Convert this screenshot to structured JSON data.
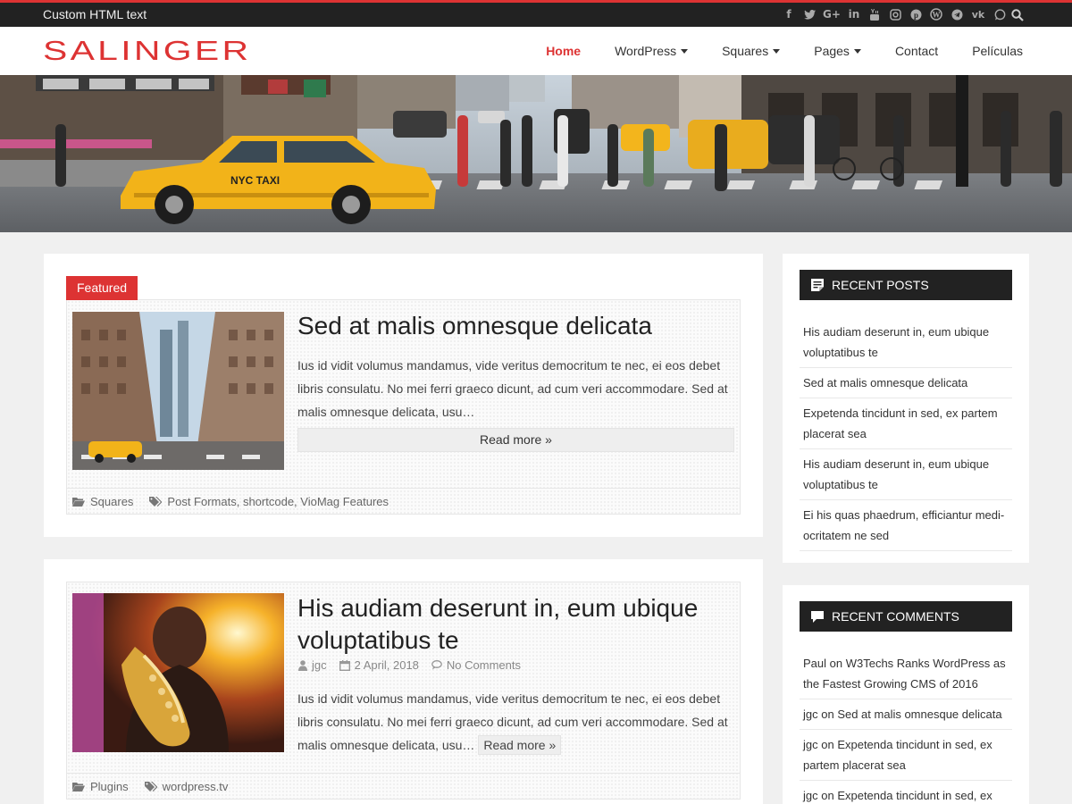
{
  "topbar": {
    "text": "Custom HTML text",
    "social_icons": [
      "facebook-icon",
      "twitter-icon",
      "google-plus-icon",
      "linkedin-icon",
      "youtube-icon",
      "instagram-icon",
      "pinterest-icon",
      "wordpress-icon",
      "telegram-icon",
      "vk-icon",
      "whatsapp-icon",
      "search-icon"
    ]
  },
  "header": {
    "logo": "SALINGER",
    "nav": [
      {
        "label": "Home",
        "active": true,
        "dropdown": false
      },
      {
        "label": "WordPress",
        "active": false,
        "dropdown": true
      },
      {
        "label": "Squares",
        "active": false,
        "dropdown": true
      },
      {
        "label": "Pages",
        "active": false,
        "dropdown": true
      },
      {
        "label": "Contact",
        "active": false,
        "dropdown": false
      },
      {
        "label": "Películas",
        "active": false,
        "dropdown": false
      }
    ]
  },
  "posts": [
    {
      "badge": "Featured",
      "title": "Sed at malis omnesque delicata",
      "excerpt": "Ius id vidit volumus mandamus, vide veritus democritum te nec, ei eos debet libris consulatu. No mei ferri graeco dicunt, ad cum veri accommodare. Sed at malis omnesque delicata, usu…",
      "read_more": "Read more »",
      "category": "Squares",
      "tags": [
        "Post Formats",
        "shortcode",
        "VioMag Features"
      ]
    },
    {
      "title": "His audiam deserunt in, eum ubique voluptatibus te",
      "author": "jgc",
      "date": "2 April, 2018",
      "comments": "No Comments",
      "excerpt": "Ius id vidit volumus mandamus, vide veritus democritum te nec, ei eos debet libris consulatu. No mei ferri graeco dicunt, ad cum veri accommodare. Sed at malis omnesque delicata, usu…",
      "read_more": "Read more »",
      "category": "Plugins",
      "tags": [
        "wordpress.tv"
      ]
    }
  ],
  "sidebar": {
    "recent_posts": {
      "title": "RECENT POSTS",
      "items": [
        "His audiam deserunt in, eum ubique voluptatibus te",
        "Sed at malis omnesque delicata",
        "Expetenda tincidunt in sed, ex partem placerat sea",
        "His audiam deserunt in, eum ubique voluptatibus te",
        "Ei his quas phaedrum, efficiantur medi-ocritatem ne sed"
      ]
    },
    "recent_comments": {
      "title": "RECENT COMMENTS",
      "items": [
        {
          "author": "Paul",
          "sep": " on ",
          "post": "W3Techs Ranks WordPress as the Fastest Growing CMS of 2016"
        },
        {
          "author": "jgc",
          "sep": " on ",
          "post": "Sed at malis omnesque delicata"
        },
        {
          "author": "jgc",
          "sep": " on ",
          "post": "Expetenda tincidunt in sed, ex partem placerat sea"
        },
        {
          "author": "jgc",
          "sep": " on ",
          "post": "Expetenda tincidunt in sed, ex"
        }
      ]
    }
  },
  "colors": {
    "accent": "#dd3333",
    "dark": "#222222",
    "background": "#f0f0f0"
  }
}
